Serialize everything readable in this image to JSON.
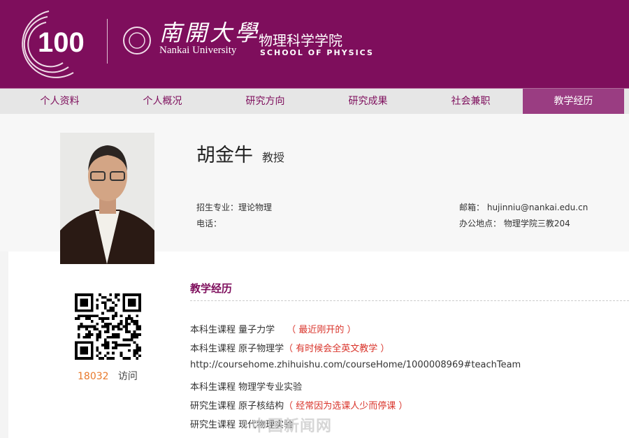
{
  "header": {
    "centennial": "100",
    "university_cn": "南開大學",
    "university_en": "Nankai University",
    "school_cn": "物理科学学院",
    "school_en": "SCHOOL OF PHYSICS"
  },
  "nav": [
    {
      "label": "个人资料"
    },
    {
      "label": "个人概况"
    },
    {
      "label": "研究方向"
    },
    {
      "label": "研究成果"
    },
    {
      "label": "社会兼职"
    },
    {
      "label": "教学经历",
      "active": true
    }
  ],
  "profile": {
    "name": "胡金牛",
    "title": "教授",
    "major_label": "招生专业：",
    "major": "理论物理",
    "phone_label": "电话：",
    "phone": "",
    "email_label": "邮箱：",
    "email": "hujinniu@nankai.edu.cn",
    "office_label": "办公地点：",
    "office": "物理学院三教204"
  },
  "stats": {
    "visits": "18032",
    "visits_label": "访问"
  },
  "section": {
    "title": "教学经历",
    "lines": [
      {
        "text": "本科生课程 量子力学　",
        "note": "（ 最近刚开的 ）"
      },
      {
        "text": "本科生课程 原子物理学",
        "note": "（ 有时候会全英文教学 ）"
      },
      {
        "text": "http://coursehome.zhihuishu.com/courseHome/1000008969#teachTeam",
        "note": ""
      },
      {
        "text": "本科生课程 物理学专业实验",
        "note": ""
      },
      {
        "text": "研究生课程 原子核结构",
        "note": "（ 经常因为选课人少而停课 ）"
      },
      {
        "text": "研究生课程 现代物理实验",
        "note": ""
      }
    ]
  },
  "watermark": "中国新闻网",
  "colors": {
    "brand": "#7e0e5c",
    "active_tab": "#9a3d82",
    "note": "#d9342b"
  }
}
